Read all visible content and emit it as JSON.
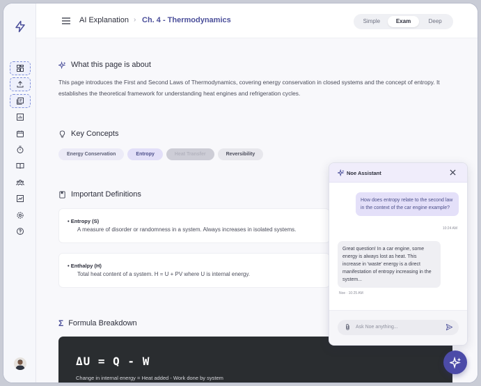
{
  "header": {
    "breadcrumb_root": "AI Explanation",
    "breadcrumb_separator": "›",
    "breadcrumb_current": "Ch. 4 - Thermodynamics",
    "modes": [
      "Simple",
      "Exam",
      "Deep"
    ],
    "active_mode": "Exam"
  },
  "sidebar": {
    "logo_icon": "lightning-icon",
    "items": [
      {
        "icon": "dashboard-icon",
        "selected": true
      },
      {
        "icon": "upload-icon",
        "selected": true
      },
      {
        "icon": "notes-icon",
        "selected": true
      },
      {
        "icon": "chart-icon",
        "selected": false
      },
      {
        "icon": "calendar-icon",
        "selected": false
      },
      {
        "icon": "timer-icon",
        "selected": false
      },
      {
        "icon": "book-icon",
        "selected": false
      },
      {
        "icon": "group-icon",
        "selected": false
      },
      {
        "icon": "analytics-icon",
        "selected": false
      },
      {
        "icon": "settings-icon",
        "selected": false
      },
      {
        "icon": "help-icon",
        "selected": false
      }
    ]
  },
  "about": {
    "title": "What this page is about",
    "text": "This page introduces the First and Second Laws of Thermodynamics, covering energy conservation in closed systems and the concept of entropy. It establishes the theoretical framework for understanding heat engines and refrigeration cycles."
  },
  "concepts": {
    "title": "Key Concepts",
    "chips": [
      "Energy Conservation",
      "Entropy",
      "Heat Transfer",
      "Reversibility"
    ]
  },
  "definitions": {
    "title": "Important Definitions",
    "items": [
      {
        "term": "Entropy (S)",
        "desc": "A measure of disorder or randomness in a system. Always increases in isolated systems."
      },
      {
        "term": "Enthalpy (H)",
        "desc": "Total heat content of a system. H = U + PV where U is internal energy."
      }
    ]
  },
  "formula": {
    "title": "Formula Breakdown",
    "equation": "ΔU = Q - W",
    "caption": "Change in internal energy = Heat added - Work done by system"
  },
  "assistant": {
    "title": "Noe Assistant",
    "user_message": "How does entropy relate to the second law in the context of the car engine example?",
    "user_time": "10:24 AM",
    "bot_message": "Great question! In a car engine, some energy is always lost as heat. This increase in 'waste' energy is a direct manifestation of entropy increasing in the system...",
    "bot_time": "Noe · 10:25 AM",
    "input_placeholder": "Ask Noe anything..."
  },
  "colors": {
    "accent": "#4c4ba8",
    "breadcrumb_active": "#4b4f9a",
    "formula_bg": "#2a2d30"
  }
}
